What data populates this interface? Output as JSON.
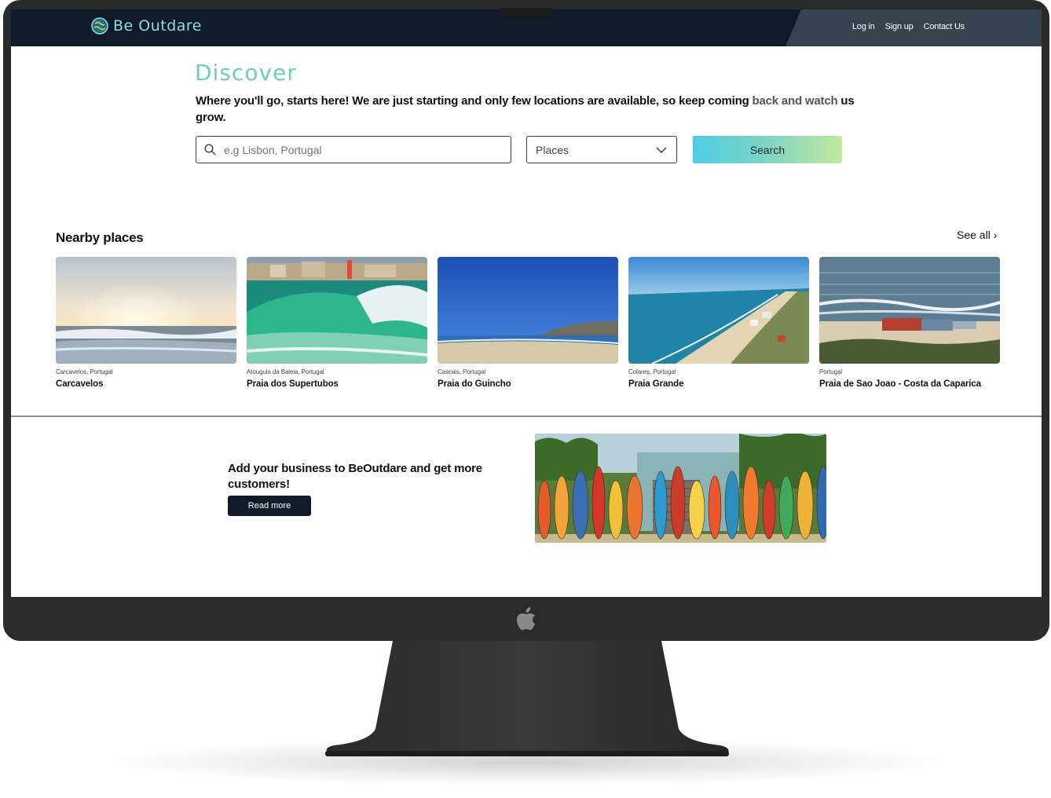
{
  "brand": {
    "name": "Be Outdare",
    "logo_icon": "globe-logo-icon"
  },
  "nav": {
    "links": [
      "Log in",
      "Sign up",
      "Contact Us"
    ]
  },
  "hero": {
    "title": "Discover",
    "intro_main": "Where you'll go, starts here! We are just starting and only few locations are available, so keep coming ",
    "intro_muted": "back and watch",
    "intro_end": " us grow."
  },
  "search": {
    "placeholder": "e.g Lisbon, Portugal",
    "category_selected": "Places",
    "button_label": "Search"
  },
  "nearby": {
    "title": "Nearby places",
    "see_all": "See all",
    "places": [
      {
        "location": "Carcavelos, Portugal",
        "name": "Carcavelos"
      },
      {
        "location": "Atouguia da Baleia, Portugal",
        "name": "Praia dos Supertubos"
      },
      {
        "location": "Cascais, Portugal",
        "name": "Praia do Guincho"
      },
      {
        "location": "Colares, Portugal",
        "name": "Praia Grande"
      },
      {
        "location": "Portugal",
        "name": "Praia de Sao Joao - Costa da Caparica"
      }
    ]
  },
  "business": {
    "text": "Add your business to BeOutdare and get more customers!",
    "button_label": "Read more"
  },
  "colors": {
    "navbar": "#0f1b29",
    "accent": "#6ccfb0",
    "brand_text": "#8fd9e3"
  }
}
